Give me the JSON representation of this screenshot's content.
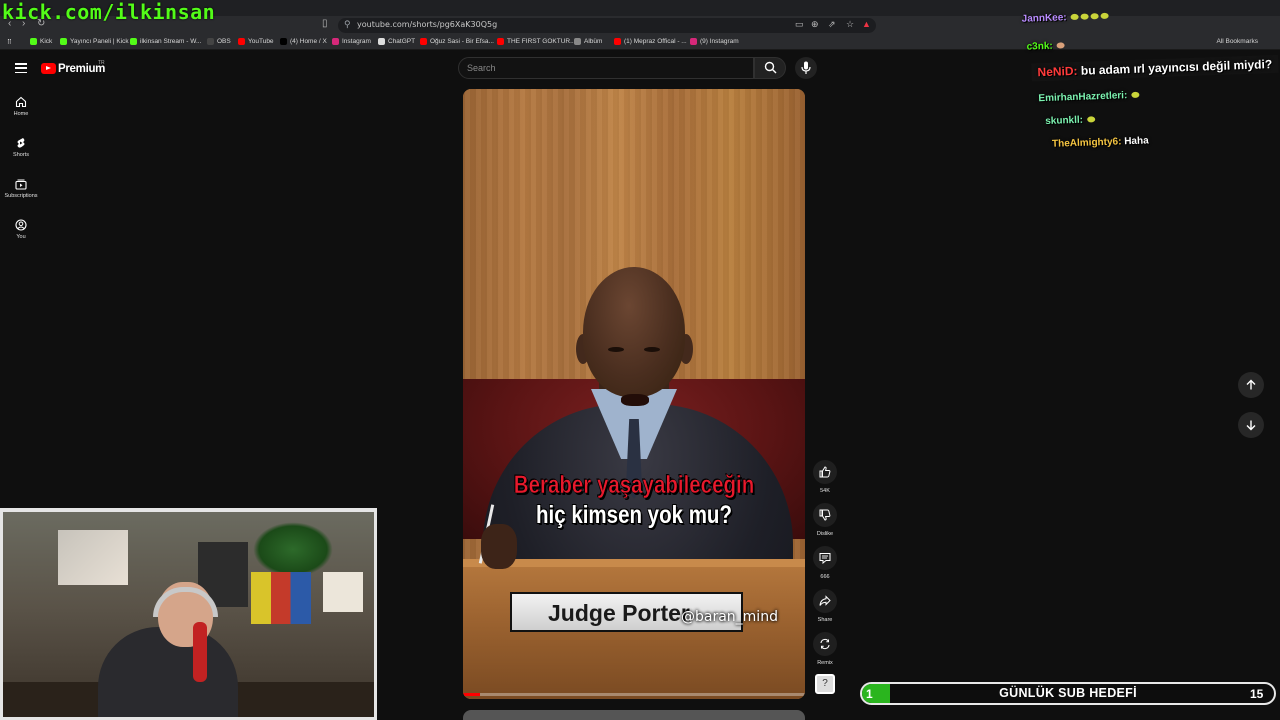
{
  "stream": {
    "watermark": "kick.com/ilkinsan"
  },
  "browser": {
    "url": "youtube.com/shorts/pg6XaK30Q5g",
    "bookmarks": [
      {
        "label": "Kick",
        "color": "#53fc18"
      },
      {
        "label": "Yayıncı Paneli | Kick",
        "color": "#53fc18"
      },
      {
        "label": "ilkinsan Stream - W...",
        "color": "#53fc18"
      },
      {
        "label": "OBS",
        "color": "#444444"
      },
      {
        "label": "YouTube",
        "color": "#ff0000"
      },
      {
        "label": "(4) Home / X",
        "color": "#000000"
      },
      {
        "label": "Instagram",
        "color": "#d6287a"
      },
      {
        "label": "ChatGPT",
        "color": "#dddddd"
      },
      {
        "label": "Oğuz Sasi - Bir Efsa...",
        "color": "#ff0000"
      },
      {
        "label": "THE FIRST GOKTUR...",
        "color": "#ff0000"
      },
      {
        "label": "Albüm",
        "color": "#888888"
      },
      {
        "label": "(1) Mepraz Offical - ...",
        "color": "#ff0000"
      },
      {
        "label": "(9) Instagram",
        "color": "#d6287a"
      }
    ],
    "all_bookmarks": "All Bookmarks"
  },
  "youtube": {
    "brand": "Premium",
    "tm": "TR",
    "search_placeholder": "Search",
    "guide": [
      {
        "label": "Home",
        "icon": "home-icon"
      },
      {
        "label": "Shorts",
        "icon": "shorts-icon"
      },
      {
        "label": "Subscriptions",
        "icon": "subscriptions-icon"
      },
      {
        "label": "You",
        "icon": "you-icon"
      }
    ],
    "short": {
      "caption_line1": "Beraber yaşayabileceğin",
      "caption_line2": "hiç kimsen yok mu?",
      "nameplate": "Judge Porter",
      "handle": "@baran_mind",
      "progress": 0.05
    },
    "actions": {
      "likes": "54K",
      "dislike": "Dislike",
      "comments": "666",
      "share": "Share",
      "remix": "Remix"
    }
  },
  "chat": [
    {
      "user": "JannKee:",
      "text": "",
      "color": "#b98cff"
    },
    {
      "user": "c3nk:",
      "text": "",
      "color": "#53fc18"
    },
    {
      "user": "NeNiD:",
      "text": "bu adam ırl yayıncısı değil miydi?",
      "color": "#ff3b3b"
    },
    {
      "user": "EmirhanHazretleri:",
      "text": "",
      "color": "#7cf2b0"
    },
    {
      "user": "skunkll:",
      "text": "",
      "color": "#7cf2b0"
    },
    {
      "user": "TheAlmighty6:",
      "text": "Haha",
      "color": "#f5c542"
    }
  ],
  "subgoal": {
    "current": "1",
    "title": "GÜNLÜK SUB HEDEFİ",
    "target": "15",
    "progress": 0.067
  }
}
